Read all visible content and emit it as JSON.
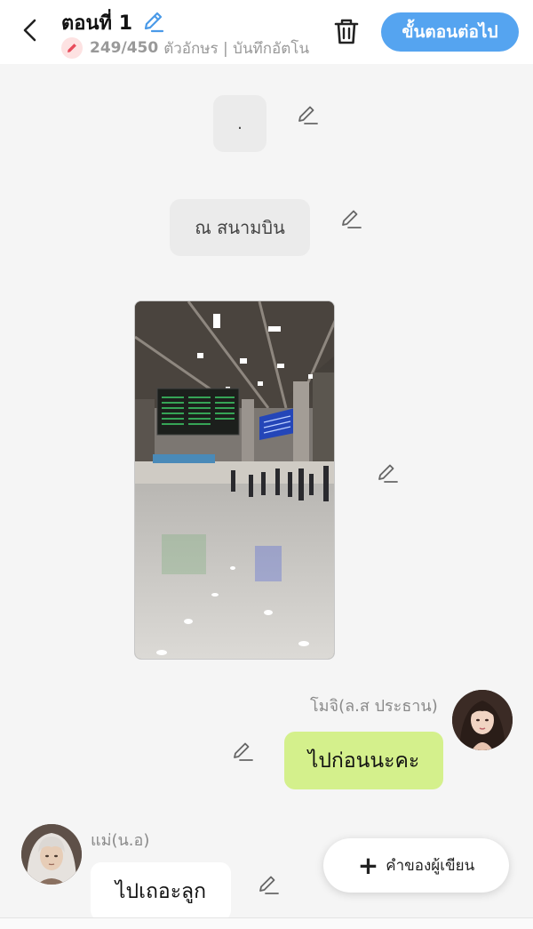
{
  "header": {
    "title": "ตอนที่ 1",
    "char_count": "249/450",
    "char_suffix": "ตัวอักษร | บันทึกอัตโนมัติ",
    "next_button": "ขั้นตอนต่อไป",
    "back_icon": "chevron-left-icon",
    "trash_icon": "trash-icon"
  },
  "story": {
    "narration_1": ".",
    "narration_2": "ณ สนามบิน",
    "image_subject": "airport terminal interior with departure boards"
  },
  "messages": [
    {
      "speaker": "โมจิ(ล.ส ประธาน)",
      "text": "ไปก่อนนะคะ",
      "side": "right"
    },
    {
      "speaker": "แม่(น.อ)",
      "text": "ไปเถอะลูก",
      "side": "left"
    }
  ],
  "fab": {
    "label": "คำของผู้เขียน",
    "icon": "plus-icon"
  },
  "colors": {
    "accent": "#55a4f0",
    "bubble_right": "#d4f08c",
    "narration_bg": "#ebebeb"
  }
}
